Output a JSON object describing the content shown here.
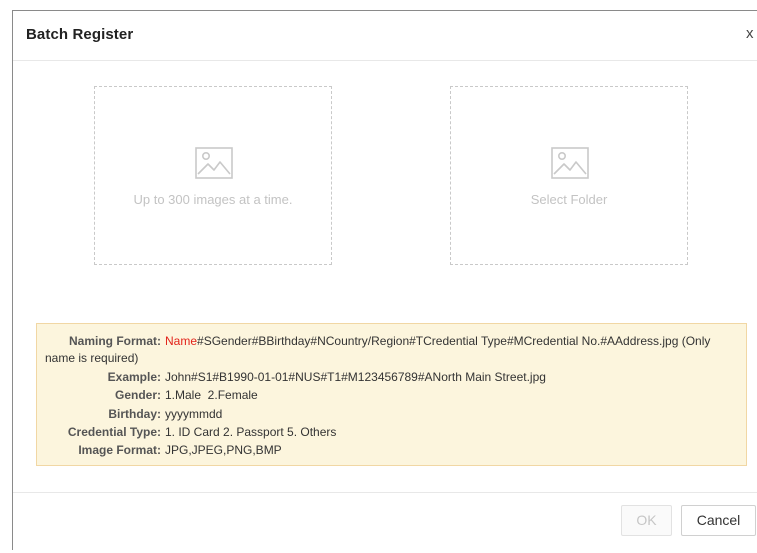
{
  "dialog": {
    "title": "Batch Register",
    "close_label": "x"
  },
  "upload": {
    "images_text": "Up to 300 images at a time.",
    "folder_text": "Select Folder",
    "icon": "image-icon"
  },
  "info": {
    "naming_format_label": "Naming Format:",
    "naming_format_name": "Name",
    "naming_format_rest": "#SGender#BBirthday#NCountry/Region#TCredential Type#MCredential No.#AAddress.jpg (Only",
    "naming_format_wrap": "name is required)",
    "example_label": "Example:",
    "example_value": "John#S1#B1990-01-01#NUS#T1#M123456789#ANorth Main Street.jpg",
    "gender_label": "Gender:",
    "gender_value": "1.Male  2.Female",
    "birthday_label": "Birthday:",
    "birthday_value": "yyyymmdd",
    "credential_label": "Credential Type:",
    "credential_value": "1. ID Card 2. Passport 5. Others",
    "image_format_label": "Image Format:",
    "image_format_value": "JPG,JPEG,PNG,BMP"
  },
  "footer": {
    "ok_label": "OK",
    "cancel_label": "Cancel"
  },
  "colors": {
    "highlight": "#e2231a",
    "info_bg": "#fcf5dd",
    "info_border": "#f1d7a4",
    "placeholder_text": "#c3c3c3"
  }
}
